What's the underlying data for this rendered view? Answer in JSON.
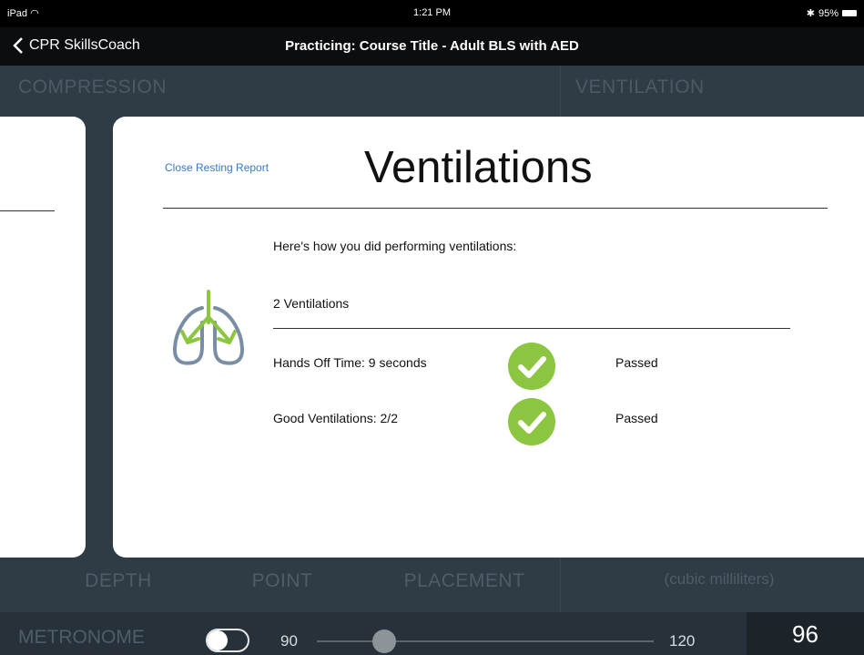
{
  "status_bar": {
    "device": "iPad",
    "wifi_icon": "wifi-icon",
    "time": "1:21 PM",
    "battery": "95%"
  },
  "nav": {
    "back_label": "CPR SkillsCoach",
    "title": "Practicing: Course Title - Adult BLS with AED"
  },
  "background": {
    "compression_label": "COMPRESSION",
    "ventilation_label": "VENTILATION",
    "bottom_labels": [
      {
        "line1": "DEPTH"
      },
      {
        "line1": "POINT"
      },
      {
        "line1": "PLACEMENT"
      },
      {
        "line1": "(cubic milliliters)"
      }
    ]
  },
  "report": {
    "close_label": "Close Resting Report",
    "title": "Ventilations",
    "intro": "Here's how you did performing ventilations:",
    "count": "2 Ventilations",
    "rows": [
      {
        "label": "Hands Off Time: 9 seconds",
        "status": "Passed"
      },
      {
        "label": "Good Ventilations: 2/2",
        "status": "Passed"
      }
    ]
  },
  "metronome": {
    "label": "METRONOME",
    "enabled": true,
    "min": "90",
    "max": "120",
    "value": "96",
    "value_number": 96
  },
  "colors": {
    "accent_green": "#8cc641",
    "link_blue": "#3a78c7",
    "lung_gray": "#7a8ea3"
  }
}
